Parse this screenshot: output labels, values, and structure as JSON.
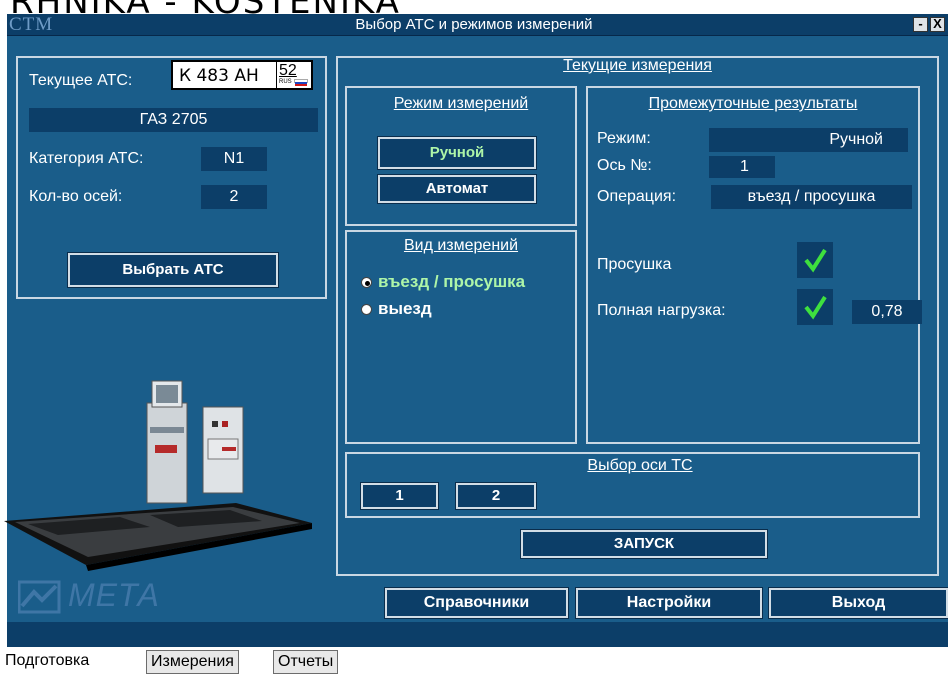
{
  "top_strip_text": "RHNIKA  -  KOSTENIKA",
  "app_logo": "CTM",
  "window_title": "Выбор АТС и режимов измерений",
  "window_buttons": {
    "minimize": "-",
    "close": "X"
  },
  "vehicle": {
    "current_label": "Текущее АТС:",
    "plate": {
      "number": "К 483 АН",
      "region": "52",
      "country": "RUS"
    },
    "model": "ГАЗ 2705",
    "category_label": "Категория АТС:",
    "category_value": "N1",
    "axles_label": "Кол-во осей:",
    "axles_value": "2",
    "select_button": "Выбрать АТС"
  },
  "measurements": {
    "title": "Текущие измерения",
    "mode_section": {
      "title": "Режим измерений",
      "manual_button": "Ручной",
      "auto_button": "Автомат"
    },
    "type_section": {
      "title": "Вид измерений",
      "options": [
        {
          "label": "въезд / просушка",
          "selected": true
        },
        {
          "label": "выезд",
          "selected": false
        }
      ]
    },
    "results": {
      "title": "Промежуточные результаты",
      "mode_label": "Режим:",
      "mode_value": "Ручной",
      "axle_label": "Ось №:",
      "axle_value": "1",
      "operation_label": "Операция:",
      "operation_value": "въезд / просушка",
      "drying_label": "Просушка",
      "drying_checked": true,
      "full_load_label": "Полная нагрузка:",
      "full_load_checked": true,
      "full_load_value": "0,78"
    },
    "axle_select": {
      "title": "Выбор оси ТС",
      "axles": [
        "1",
        "2"
      ]
    },
    "start_button": "ЗАПУСК"
  },
  "brand_logo": "МЕТА",
  "bottom_buttons": {
    "references": "Справочники",
    "settings": "Настройки",
    "exit": "Выход"
  },
  "tabs": [
    "Подготовка",
    "Измерения",
    "Отчеты"
  ],
  "colors": {
    "background": "#1a5d8a",
    "dark_field": "#0c3e68",
    "selected_text": "#aef5a8",
    "check": "#3ee03e"
  }
}
